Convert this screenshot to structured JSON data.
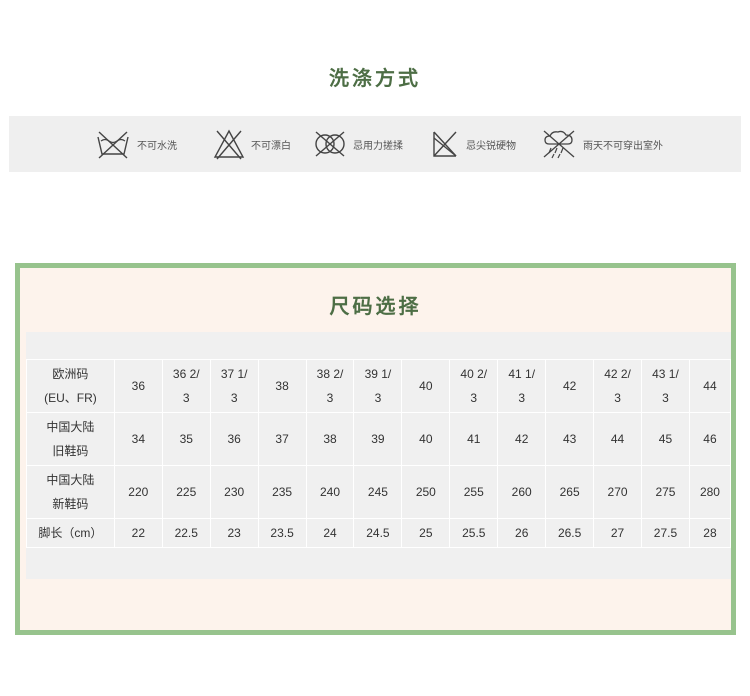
{
  "care": {
    "title": "洗涤方式",
    "items": [
      {
        "label": "不可水洗",
        "icon": "no-wash-icon"
      },
      {
        "label": "不可漂白",
        "icon": "no-bleach-icon"
      },
      {
        "label": "忌用力搓揉",
        "icon": "no-wring-icon"
      },
      {
        "label": "忌尖锐硬物",
        "icon": "no-sharp-objects-icon"
      },
      {
        "label": "雨天不可穿出室外",
        "icon": "no-rain-icon"
      }
    ]
  },
  "size": {
    "title": "尺码选择",
    "rows": [
      {
        "header_lines": [
          "欧洲码",
          "(EU、FR)"
        ],
        "cells": [
          [
            "36"
          ],
          [
            "36 2/",
            "3"
          ],
          [
            "37 1/",
            "3"
          ],
          [
            "38"
          ],
          [
            "38 2/",
            "3"
          ],
          [
            "39 1/",
            "3"
          ],
          [
            "40"
          ],
          [
            "40 2/",
            "3"
          ],
          [
            "41 1/",
            "3"
          ],
          [
            "42"
          ],
          [
            "42 2/",
            "3"
          ],
          [
            "43 1/",
            "3"
          ],
          [
            "44"
          ]
        ]
      },
      {
        "header_lines": [
          "中国大陆",
          "旧鞋码"
        ],
        "cells": [
          [
            "34"
          ],
          [
            "35"
          ],
          [
            "36"
          ],
          [
            "37"
          ],
          [
            "38"
          ],
          [
            "39"
          ],
          [
            "40"
          ],
          [
            "41"
          ],
          [
            "42"
          ],
          [
            "43"
          ],
          [
            "44"
          ],
          [
            "45"
          ],
          [
            "46"
          ]
        ]
      },
      {
        "header_lines": [
          "中国大陆",
          "新鞋码"
        ],
        "cells": [
          [
            "220"
          ],
          [
            "225"
          ],
          [
            "230"
          ],
          [
            "235"
          ],
          [
            "240"
          ],
          [
            "245"
          ],
          [
            "250"
          ],
          [
            "255"
          ],
          [
            "260"
          ],
          [
            "265"
          ],
          [
            "270"
          ],
          [
            "275"
          ],
          [
            "280"
          ]
        ]
      },
      {
        "header_lines": [
          "脚长（cm）"
        ],
        "cells": [
          [
            "22"
          ],
          [
            "22.5"
          ],
          [
            "23"
          ],
          [
            "23.5"
          ],
          [
            "24"
          ],
          [
            "24.5"
          ],
          [
            "25"
          ],
          [
            "25.5"
          ],
          [
            "26"
          ],
          [
            "26.5"
          ],
          [
            "27"
          ],
          [
            "27.5"
          ],
          [
            "28"
          ]
        ]
      }
    ]
  },
  "colors": {
    "accent_green": "#4d6e45",
    "frame_green": "#97c38d",
    "band_gray": "#efefef",
    "cream": "#fdf3ec"
  }
}
